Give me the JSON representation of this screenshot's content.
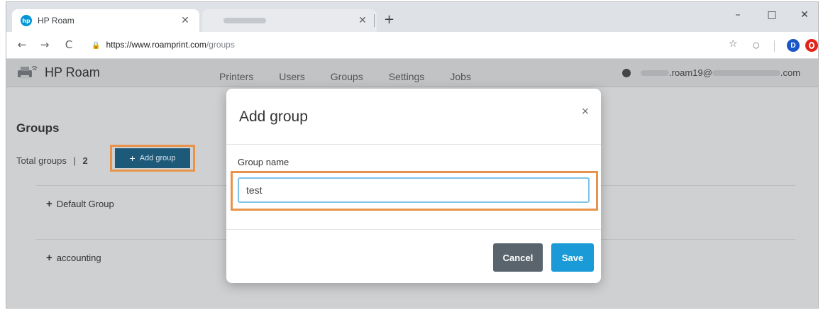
{
  "browser": {
    "active_tab_title": "HP Roam",
    "url_host": "https://www.roamprint.com",
    "url_path": "/groups",
    "controls": {
      "minimize": "–",
      "maximize": "□",
      "close": "✕",
      "new_tab": "+",
      "back": "←",
      "forward": "→",
      "reload": "C",
      "star": "☆",
      "extension_d": "D"
    }
  },
  "app": {
    "brand": "HP Roam",
    "nav": [
      "Printers",
      "Users",
      "Groups",
      "Settings",
      "Jobs"
    ],
    "user_email_partial_start": ".roam19@",
    "user_email_partial_end": ".com"
  },
  "groups_page": {
    "title": "Groups",
    "total_label": "Total groups",
    "separator": "|",
    "total_count": "2",
    "add_group_label": "Add group",
    "groups": [
      "Default Group",
      "accounting"
    ]
  },
  "modal": {
    "title": "Add group",
    "close": "×",
    "field_label": "Group name",
    "field_value": "test",
    "cancel_label": "Cancel",
    "save_label": "Save"
  },
  "colors": {
    "highlight_outline": "#e8934c",
    "save_button": "#1a9ad6",
    "cancel_button": "#5a646d",
    "add_group_button": "#1d5a7a"
  }
}
